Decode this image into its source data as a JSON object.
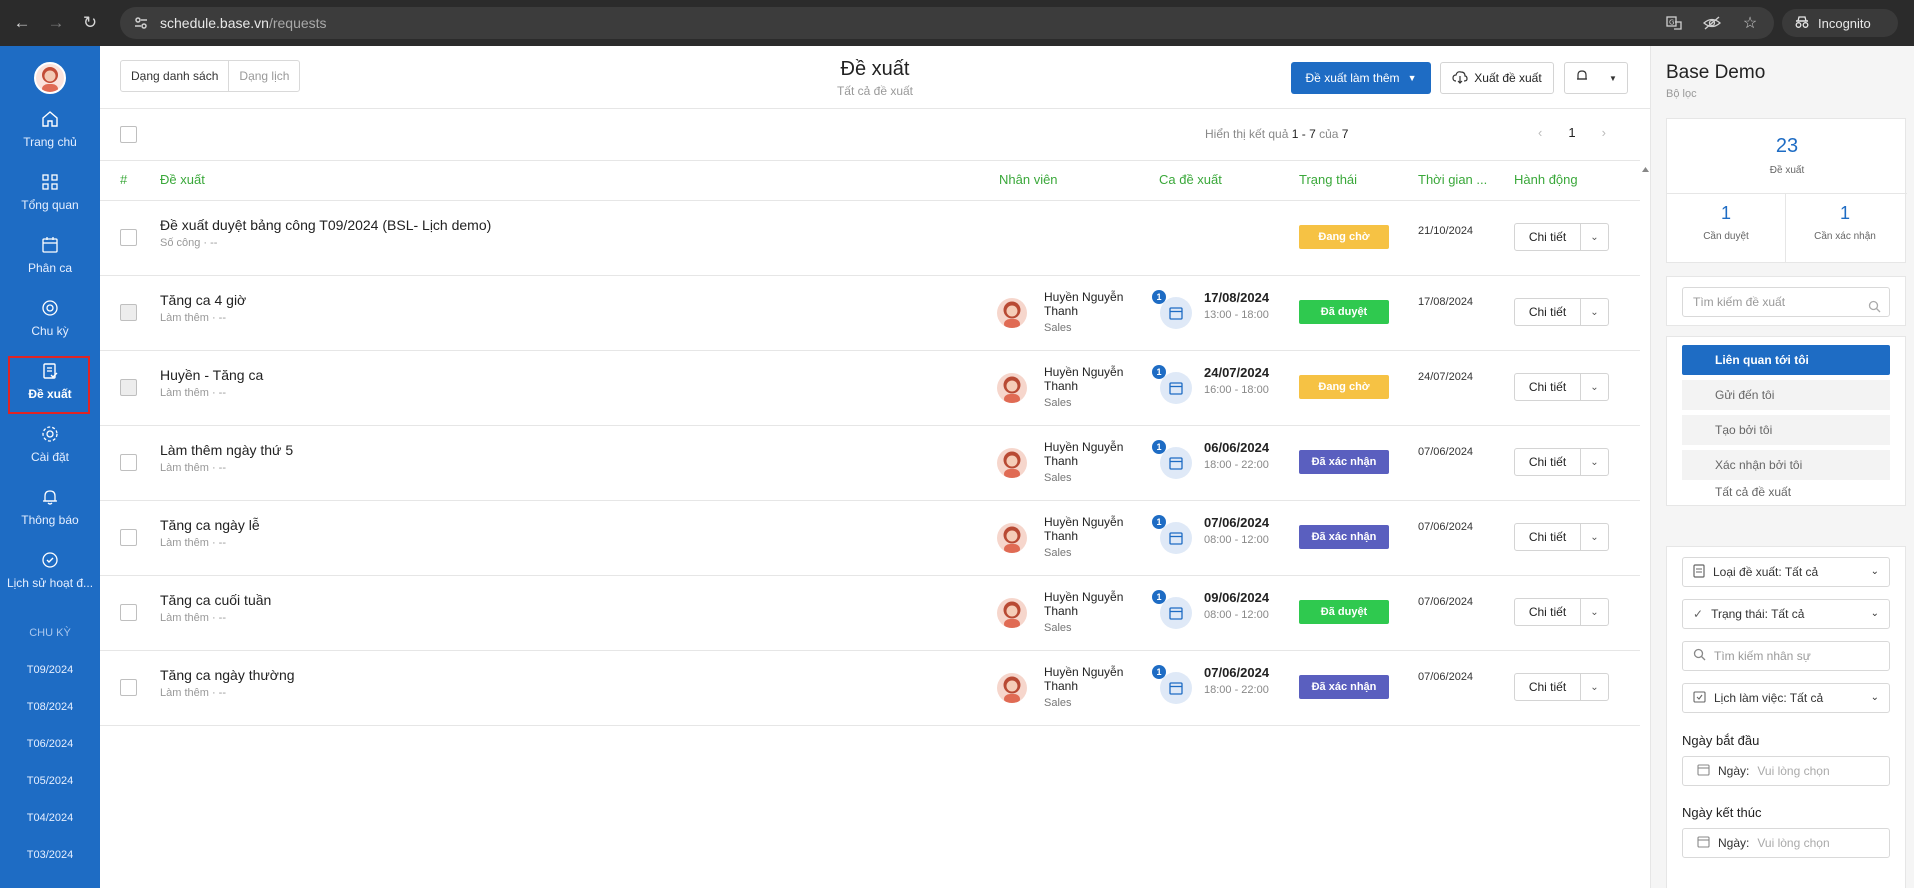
{
  "browser": {
    "url_host": "schedule.base.vn",
    "url_path": "/requests",
    "mode_label": "Incognito"
  },
  "sidebar": {
    "items": [
      {
        "label": "Trang chủ",
        "icon": "home-icon"
      },
      {
        "label": "Tổng quan",
        "icon": "grid-icon"
      },
      {
        "label": "Phân ca",
        "icon": "calendar-icon"
      },
      {
        "label": "Chu kỳ",
        "icon": "cycle-icon"
      },
      {
        "label": "Đề xuất",
        "icon": "request-icon",
        "active": true
      },
      {
        "label": "Cài đặt",
        "icon": "gear-icon"
      },
      {
        "label": "Thông báo",
        "icon": "bell-icon"
      },
      {
        "label": "Lịch sử hoạt đ...",
        "icon": "check-circle-icon"
      }
    ],
    "section_label": "CHU KỲ",
    "periods": [
      "T09/2024",
      "T08/2024",
      "T06/2024",
      "T05/2024",
      "T04/2024",
      "T03/2024"
    ]
  },
  "header": {
    "view_list": "Dạng danh sách",
    "view_calendar": "Dạng lịch",
    "title": "Đề xuất",
    "subtitle": "Tất cả đề xuất",
    "primary_button": "Đề xuất làm thêm",
    "export_button": "Xuất đề xuất"
  },
  "results": {
    "prefix": "Hiển thị kết quả",
    "range": "1 - 7",
    "of": "của",
    "total": "7",
    "page": "1"
  },
  "table": {
    "columns": {
      "index": "#",
      "request": "Đề xuất",
      "employee": "Nhân viên",
      "shift": "Ca đề xuất",
      "status": "Trạng thái",
      "time": "Thời gian ...",
      "action": "Hành động"
    },
    "action_label": "Chi tiết",
    "rows": [
      {
        "title": "Đề xuất duyệt bảng công T09/2024 (BSL- Lịch demo)",
        "sub": "Số công · --",
        "employee": "",
        "dept": "",
        "shift_date": "",
        "shift_time": "",
        "status": "Đang chờ",
        "status_type": "pending",
        "time": "21/10/2024"
      },
      {
        "title": "Tăng ca 4 giờ",
        "sub": "Làm thêm · --",
        "employee": "Huyền Nguyễn Thanh",
        "dept": "Sales",
        "shift_count": "1",
        "shift_date": "17/08/2024",
        "shift_time": "13:00 - 18:00",
        "status": "Đã duyệt",
        "status_type": "approved",
        "time": "17/08/2024"
      },
      {
        "title": "Huyền - Tăng ca",
        "sub": "Làm thêm · --",
        "employee": "Huyền Nguyễn Thanh",
        "dept": "Sales",
        "shift_count": "1",
        "shift_date": "24/07/2024",
        "shift_time": "16:00 - 18:00",
        "status": "Đang chờ",
        "status_type": "pending",
        "time": "24/07/2024"
      },
      {
        "title": "Làm thêm ngày thứ 5",
        "sub": "Làm thêm · --",
        "employee": "Huyền Nguyễn Thanh",
        "dept": "Sales",
        "shift_count": "1",
        "shift_date": "06/06/2024",
        "shift_time": "18:00 - 22:00",
        "status": "Đã xác nhận",
        "status_type": "confirmed",
        "time": "07/06/2024"
      },
      {
        "title": "Tăng ca ngày lễ",
        "sub": "Làm thêm · --",
        "employee": "Huyền Nguyễn Thanh",
        "dept": "Sales",
        "shift_count": "1",
        "shift_date": "07/06/2024",
        "shift_time": "08:00 - 12:00",
        "status": "Đã xác nhận",
        "status_type": "confirmed",
        "time": "07/06/2024"
      },
      {
        "title": "Tăng ca cuối tuần",
        "sub": "Làm thêm · --",
        "employee": "Huyền Nguyễn Thanh",
        "dept": "Sales",
        "shift_count": "1",
        "shift_date": "09/06/2024",
        "shift_time": "08:00 - 12:00",
        "status": "Đã duyệt",
        "status_type": "approved",
        "time": "07/06/2024"
      },
      {
        "title": "Tăng ca ngày thường",
        "sub": "Làm thêm · --",
        "employee": "Huyền Nguyễn Thanh",
        "dept": "Sales",
        "shift_count": "1",
        "shift_date": "07/06/2024",
        "shift_time": "18:00 - 22:00",
        "status": "Đã xác nhận",
        "status_type": "confirmed",
        "time": "07/06/2024"
      }
    ]
  },
  "panel": {
    "title": "Base Demo",
    "subtitle": "Bộ lọc",
    "total": "23",
    "total_label": "Đề xuất",
    "need_approve": "1",
    "need_approve_label": "Cần duyệt",
    "need_confirm": "1",
    "need_confirm_label": "Cần xác nhận",
    "search_placeholder": "Tìm kiếm đề xuất",
    "filters": [
      "Liên quan tới tôi",
      "Gửi đến tôi",
      "Tạo bởi tôi",
      "Xác nhận bởi tôi",
      "Tất cả đề xuất"
    ],
    "type_select": "Loại đề xuất: Tất cả",
    "status_select": "Trạng thái: Tất cả",
    "staff_search": "Tìm kiếm nhân sự",
    "schedule_select": "Lịch làm việc: Tất cả",
    "start_label": "Ngày bắt đầu",
    "end_label": "Ngày kết thúc",
    "date_prefix": "Ngày:",
    "date_placeholder": "Vui lòng chọn"
  },
  "colors": {
    "brand": "#1e6cc4",
    "header_green": "#3aa83a",
    "pending": "#f6c244",
    "approved": "#2fc94f",
    "confirmed": "#5a5fbf"
  }
}
